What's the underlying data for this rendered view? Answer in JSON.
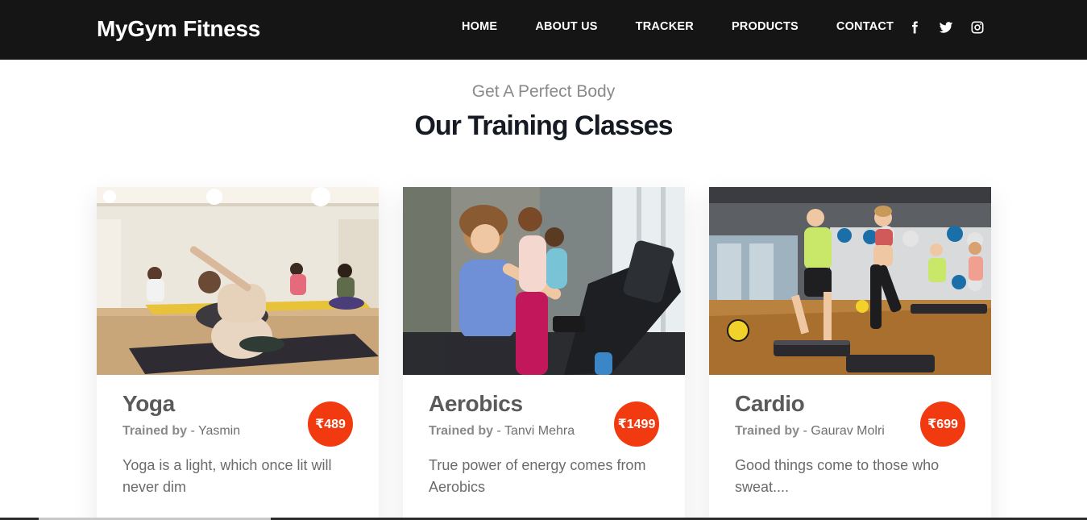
{
  "brand": "MyGym Fitness",
  "nav": [
    {
      "label": "HOME"
    },
    {
      "label": "ABOUT US"
    },
    {
      "label": "TRACKER"
    },
    {
      "label": "PRODUCTS"
    },
    {
      "label": "CONTACT"
    }
  ],
  "socials": [
    "facebook-icon",
    "twitter-icon",
    "instagram-icon"
  ],
  "section": {
    "subheading": "Get A Perfect Body",
    "heading": "Our Training Classes"
  },
  "classes": [
    {
      "title": "Yoga",
      "trained_by_label": "Trained by",
      "trainer": " - Yasmin",
      "price": "₹489",
      "description": "Yoga is a light, which once lit will never dim",
      "image": "yoga-class-photo"
    },
    {
      "title": "Aerobics",
      "trained_by_label": "Trained by",
      "trainer": " - Tanvi Mehra",
      "price": "₹1499",
      "description": "True power of energy comes from Aerobics",
      "image": "aerobics-class-photo"
    },
    {
      "title": "Cardio",
      "trained_by_label": "Trained by",
      "trainer": " - Gaurav Molri",
      "price": "₹699",
      "description": "Good things come to those who sweat....",
      "image": "cardio-class-photo"
    }
  ],
  "colors": {
    "navbar": "#151515",
    "accent": "#f13a10",
    "title": "#5a5a5a",
    "heading": "#161a22"
  }
}
